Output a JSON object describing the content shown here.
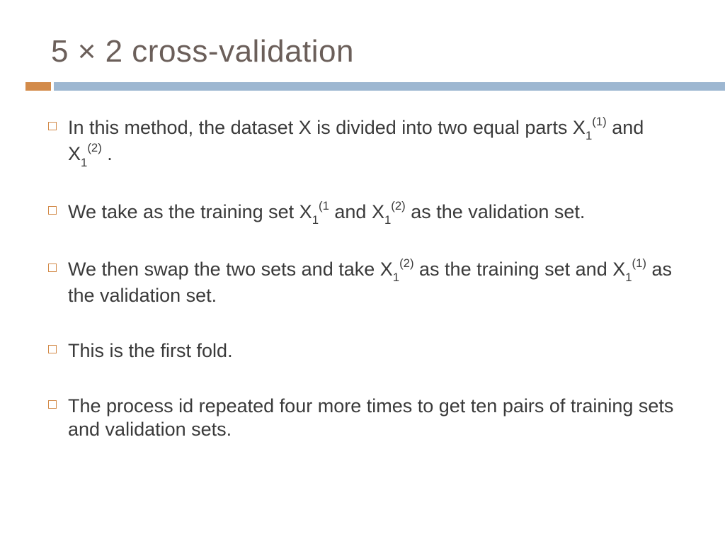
{
  "title": "5 × 2 cross-validation",
  "bullets": [
    {
      "pre": "In this method, the dataset X is divided into two equal parts X",
      "sub1": "1",
      "sup1": "(1)",
      "mid": " and X",
      "sub2": "1",
      "sup2": "(2)",
      "post": " ."
    },
    {
      "pre": "We take as the training set X",
      "sub1": "1",
      "sup1": "(1",
      "mid": " and X",
      "sub2": "1",
      "sup2": "(2)",
      "post": "  as the validation set."
    },
    {
      "pre": "We then swap the two sets and take X",
      "sub1": "1",
      "sup1": "(2)",
      "mid": "  as the training set and X",
      "sub2": "1",
      "sup2": "(1)",
      "post": "  as the validation set."
    },
    {
      "pre": "This is the first fold."
    },
    {
      "pre": "The process id repeated four more times to get ten pairs of training sets and validation sets."
    }
  ],
  "colors": {
    "title": "#6b5f5a",
    "accent": "#d38b4a",
    "bar": "#9db7d1",
    "text": "#3a3a3a"
  }
}
